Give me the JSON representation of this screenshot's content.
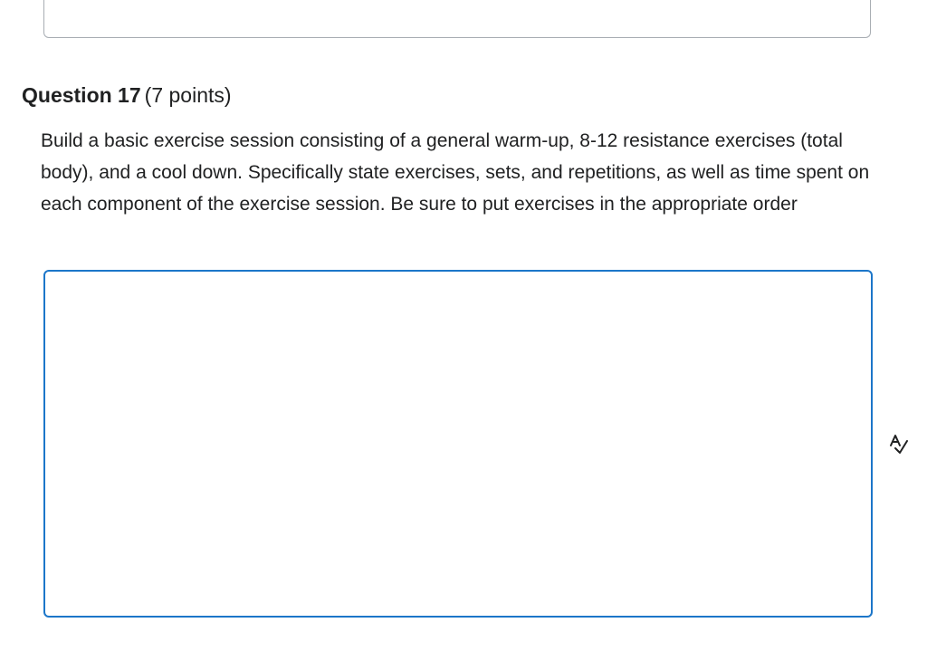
{
  "question": {
    "title": "Question 17",
    "points": "(7 points)",
    "prompt": "Build a basic exercise session consisting of a general warm-up, 8-12 resistance exercises (total body), and a cool down. Specifically state exercises, sets, and repetitions, as well as time spent on each component of the exercise session. Be sure to put exercises in the appropriate order"
  },
  "answer": {
    "value": ""
  },
  "icons": {
    "spellcheck": "spellcheck-icon"
  },
  "colors": {
    "focus_border": "#1c76c9",
    "text": "#202122",
    "inactive_border": "#a8adb3"
  }
}
